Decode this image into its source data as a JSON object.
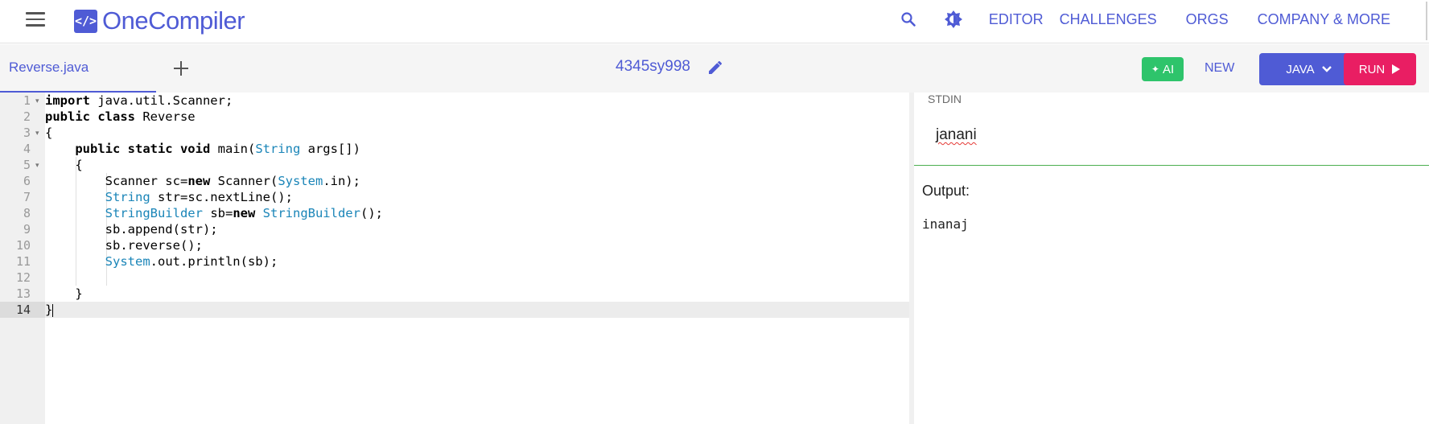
{
  "header": {
    "logo_mark": "</>",
    "logo_text": "OneCompiler",
    "nav": [
      "EDITOR",
      "CHALLENGES",
      "ORGS",
      "COMPANY & MORE"
    ]
  },
  "toolbar": {
    "file_tab": "Reverse.java",
    "code_id": "4345sy998",
    "ai_label": "AI",
    "new_label": "NEW",
    "language_label": "JAVA",
    "run_label": "RUN"
  },
  "editor": {
    "line_numbers": [
      "1",
      "2",
      "3",
      "4",
      "5",
      "6",
      "7",
      "8",
      "9",
      "10",
      "11",
      "12",
      "13",
      "14"
    ],
    "active_line": 14
  },
  "io": {
    "stdin_label": "STDIN",
    "stdin_value": "janani",
    "output_label": "Output:",
    "output_value": "inanaj"
  },
  "colors": {
    "brand": "#4f5bd5",
    "run": "#e91e63",
    "ai": "#2ec46b",
    "type_keyword": "#1a85b8"
  }
}
